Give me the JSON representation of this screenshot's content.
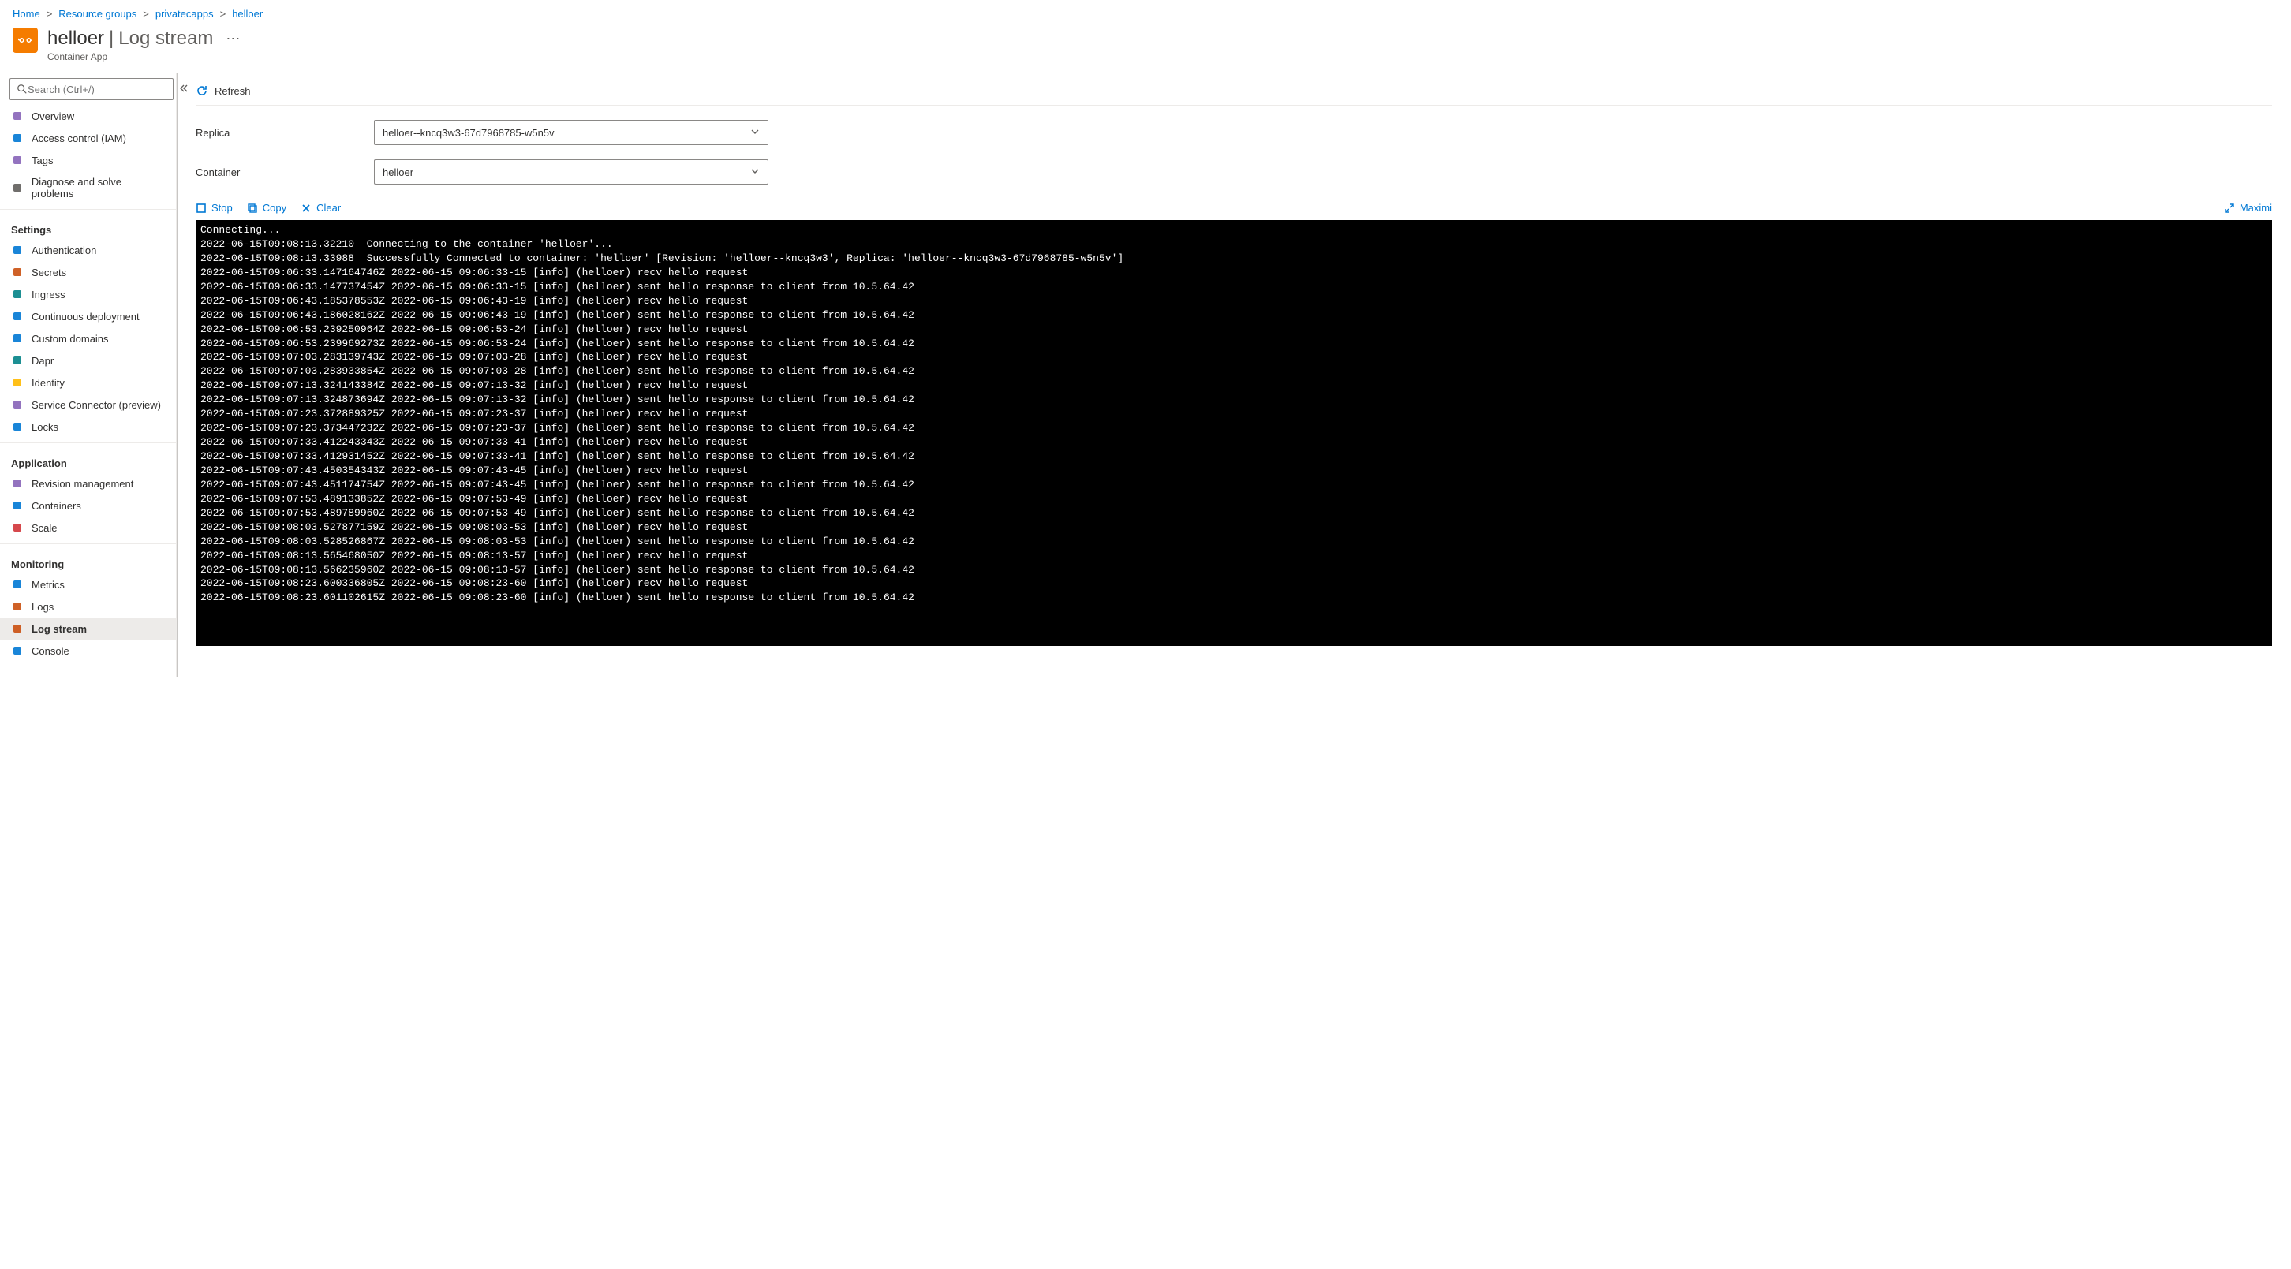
{
  "breadcrumb": [
    {
      "label": "Home"
    },
    {
      "label": "Resource groups"
    },
    {
      "label": "privatecapps"
    },
    {
      "label": "helloer"
    }
  ],
  "header": {
    "title": "helloer",
    "section": "Log stream",
    "subtitle": "Container App"
  },
  "sidebar": {
    "search_placeholder": "Search (Ctrl+/)",
    "top": [
      {
        "id": "overview",
        "label": "Overview",
        "color": "i-purple"
      },
      {
        "id": "iam",
        "label": "Access control (IAM)",
        "color": "i-blue"
      },
      {
        "id": "tags",
        "label": "Tags",
        "color": "i-purple"
      },
      {
        "id": "diag",
        "label": "Diagnose and solve problems",
        "color": "i-gray"
      }
    ],
    "groups": [
      {
        "title": "Settings",
        "items": [
          {
            "id": "auth",
            "label": "Authentication",
            "color": "i-blue"
          },
          {
            "id": "secrets",
            "label": "Secrets",
            "color": "i-orange"
          },
          {
            "id": "ingress",
            "label": "Ingress",
            "color": "i-teal"
          },
          {
            "id": "cd",
            "label": "Continuous deployment",
            "color": "i-blue"
          },
          {
            "id": "domains",
            "label": "Custom domains",
            "color": "i-blue"
          },
          {
            "id": "dapr",
            "label": "Dapr",
            "color": "i-teal"
          },
          {
            "id": "identity",
            "label": "Identity",
            "color": "i-yellow"
          },
          {
            "id": "svcconn",
            "label": "Service Connector (preview)",
            "color": "i-purple"
          },
          {
            "id": "locks",
            "label": "Locks",
            "color": "i-blue"
          }
        ]
      },
      {
        "title": "Application",
        "items": [
          {
            "id": "revmgmt",
            "label": "Revision management",
            "color": "i-purple"
          },
          {
            "id": "containers",
            "label": "Containers",
            "color": "i-blue"
          },
          {
            "id": "scale",
            "label": "Scale",
            "color": "i-red"
          }
        ]
      },
      {
        "title": "Monitoring",
        "items": [
          {
            "id": "metrics",
            "label": "Metrics",
            "color": "i-blue"
          },
          {
            "id": "logs",
            "label": "Logs",
            "color": "i-orange"
          },
          {
            "id": "logstream",
            "label": "Log stream",
            "color": "i-orange",
            "active": true
          },
          {
            "id": "console",
            "label": "Console",
            "color": "i-blue"
          }
        ]
      }
    ]
  },
  "toolbar": {
    "refresh": "Refresh"
  },
  "form": {
    "replica_label": "Replica",
    "replica_value": "helloer--kncq3w3-67d7968785-w5n5v",
    "container_label": "Container",
    "container_value": "helloer"
  },
  "log_toolbar": {
    "stop": "Stop",
    "copy": "Copy",
    "clear": "Clear",
    "maximize": "Maximi"
  },
  "log_lines": [
    "Connecting...",
    "2022-06-15T09:08:13.32210  Connecting to the container 'helloer'...",
    "2022-06-15T09:08:13.33988  Successfully Connected to container: 'helloer' [Revision: 'helloer--kncq3w3', Replica: 'helloer--kncq3w3-67d7968785-w5n5v']",
    "2022-06-15T09:06:33.147164746Z 2022-06-15 09:06:33-15 [info] (helloer) recv hello request",
    "2022-06-15T09:06:33.147737454Z 2022-06-15 09:06:33-15 [info] (helloer) sent hello response to client from 10.5.64.42",
    "2022-06-15T09:06:43.185378553Z 2022-06-15 09:06:43-19 [info] (helloer) recv hello request",
    "2022-06-15T09:06:43.186028162Z 2022-06-15 09:06:43-19 [info] (helloer) sent hello response to client from 10.5.64.42",
    "2022-06-15T09:06:53.239250964Z 2022-06-15 09:06:53-24 [info] (helloer) recv hello request",
    "2022-06-15T09:06:53.239969273Z 2022-06-15 09:06:53-24 [info] (helloer) sent hello response to client from 10.5.64.42",
    "2022-06-15T09:07:03.283139743Z 2022-06-15 09:07:03-28 [info] (helloer) recv hello request",
    "2022-06-15T09:07:03.283933854Z 2022-06-15 09:07:03-28 [info] (helloer) sent hello response to client from 10.5.64.42",
    "2022-06-15T09:07:13.324143384Z 2022-06-15 09:07:13-32 [info] (helloer) recv hello request",
    "2022-06-15T09:07:13.324873694Z 2022-06-15 09:07:13-32 [info] (helloer) sent hello response to client from 10.5.64.42",
    "2022-06-15T09:07:23.372889325Z 2022-06-15 09:07:23-37 [info] (helloer) recv hello request",
    "2022-06-15T09:07:23.373447232Z 2022-06-15 09:07:23-37 [info] (helloer) sent hello response to client from 10.5.64.42",
    "2022-06-15T09:07:33.412243343Z 2022-06-15 09:07:33-41 [info] (helloer) recv hello request",
    "2022-06-15T09:07:33.412931452Z 2022-06-15 09:07:33-41 [info] (helloer) sent hello response to client from 10.5.64.42",
    "2022-06-15T09:07:43.450354343Z 2022-06-15 09:07:43-45 [info] (helloer) recv hello request",
    "2022-06-15T09:07:43.451174754Z 2022-06-15 09:07:43-45 [info] (helloer) sent hello response to client from 10.5.64.42",
    "2022-06-15T09:07:53.489133852Z 2022-06-15 09:07:53-49 [info] (helloer) recv hello request",
    "2022-06-15T09:07:53.489789960Z 2022-06-15 09:07:53-49 [info] (helloer) sent hello response to client from 10.5.64.42",
    "2022-06-15T09:08:03.527877159Z 2022-06-15 09:08:03-53 [info] (helloer) recv hello request",
    "2022-06-15T09:08:03.528526867Z 2022-06-15 09:08:03-53 [info] (helloer) sent hello response to client from 10.5.64.42",
    "2022-06-15T09:08:13.565468050Z 2022-06-15 09:08:13-57 [info] (helloer) recv hello request",
    "2022-06-15T09:08:13.566235960Z 2022-06-15 09:08:13-57 [info] (helloer) sent hello response to client from 10.5.64.42",
    "2022-06-15T09:08:23.600336805Z 2022-06-15 09:08:23-60 [info] (helloer) recv hello request",
    "2022-06-15T09:08:23.601102615Z 2022-06-15 09:08:23-60 [info] (helloer) sent hello response to client from 10.5.64.42"
  ]
}
